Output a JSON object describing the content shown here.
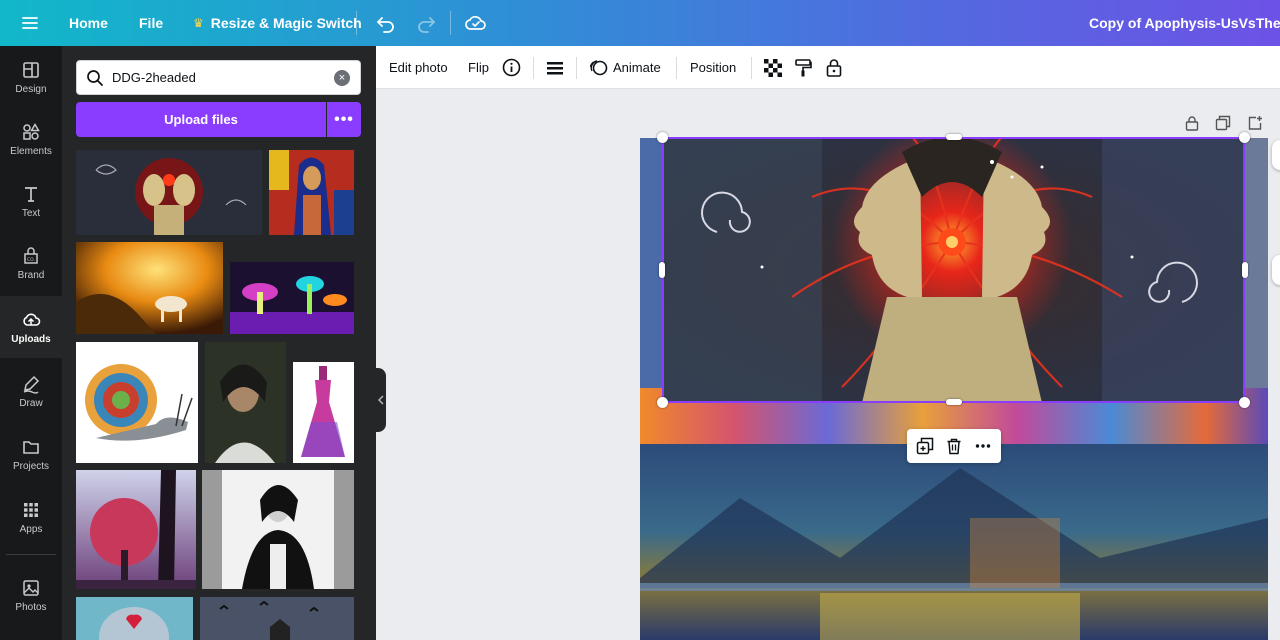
{
  "topbar": {
    "home": "Home",
    "file": "File",
    "resize": "Resize & Magic Switch",
    "doc_title": "Copy of Apophysis-UsVsTheUniverse",
    "icons": [
      "menu-icon",
      "crown-icon",
      "undo-icon",
      "redo-icon",
      "cloud-saved-icon"
    ]
  },
  "rail": {
    "items": [
      {
        "label": "Design",
        "icon": "design-icon"
      },
      {
        "label": "Elements",
        "icon": "elements-icon"
      },
      {
        "label": "Text",
        "icon": "text-icon"
      },
      {
        "label": "Brand",
        "icon": "brand-icon"
      },
      {
        "label": "Uploads",
        "icon": "upload-cloud-icon",
        "active": true
      },
      {
        "label": "Draw",
        "icon": "draw-icon"
      },
      {
        "label": "Projects",
        "icon": "folder-icon"
      },
      {
        "label": "Apps",
        "icon": "apps-grid-icon"
      },
      {
        "label": "Photos",
        "icon": "photos-icon"
      }
    ]
  },
  "panel": {
    "search_value": "DDG-2headed",
    "upload_label": "Upload files",
    "more_label": "•••"
  },
  "toolbar": {
    "edit_photo": "Edit photo",
    "flip": "Flip",
    "animate": "Animate",
    "position": "Position",
    "icons": [
      "info-icon",
      "border-style-icon",
      "animate-icon",
      "transparency-icon",
      "copy-style-icon",
      "lock-icon"
    ]
  },
  "floating_toolbar": {
    "icons": [
      "duplicate-icon",
      "trash-icon",
      "more-icon"
    ],
    "more_label": "•••"
  },
  "colors": {
    "accent": "#8b3dff",
    "topbar_start": "#11b8c9",
    "topbar_end": "#6d52e6",
    "rail_bg": "#18191b",
    "panel_bg": "#252627",
    "canvas_bg": "#ebecf0"
  }
}
